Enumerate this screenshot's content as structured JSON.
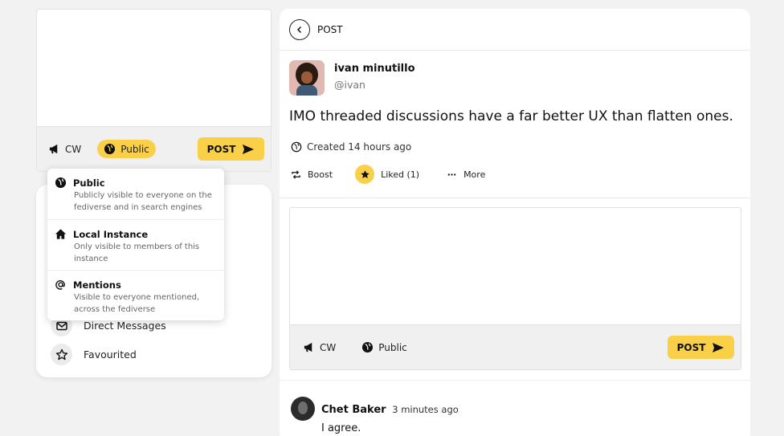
{
  "left_composer": {
    "cw_label": "CW",
    "visibility_label": "Public",
    "post_label": "POST"
  },
  "visibility_menu": {
    "options": [
      {
        "title": "Public",
        "description": "Publicly visible to everyone on the fediverse and in search engines",
        "icon": "globe-icon"
      },
      {
        "title": "Local Instance",
        "description": "Only visible to members of this instance",
        "icon": "home-icon"
      },
      {
        "title": "Mentions",
        "description": "Visible to everyone mentioned, across the fediverse",
        "icon": "at-icon"
      }
    ]
  },
  "nav": {
    "items": [
      {
        "label": "Direct Messages",
        "icon": "envelope-icon"
      },
      {
        "label": "Favourited",
        "icon": "star-icon"
      }
    ]
  },
  "main": {
    "title": "POST",
    "post": {
      "author_name": "ivan minutillo",
      "author_handle": "@ivan",
      "text": "IMO threaded discussions have a far better UX than flatten ones.",
      "created": "Created 14 hours ago",
      "boost_label": "Boost",
      "liked_label": "Liked (1)",
      "more_label": "More"
    },
    "reply_composer": {
      "cw_label": "CW",
      "visibility_label": "Public",
      "post_label": "POST"
    },
    "comment": {
      "author": "Chet Baker",
      "time": "3 minutes ago",
      "text": "I agree."
    }
  },
  "colors": {
    "accent": "#fbd049",
    "background": "#f2f2f2",
    "panel": "#ffffff",
    "toolbar": "#f0f0f0"
  }
}
